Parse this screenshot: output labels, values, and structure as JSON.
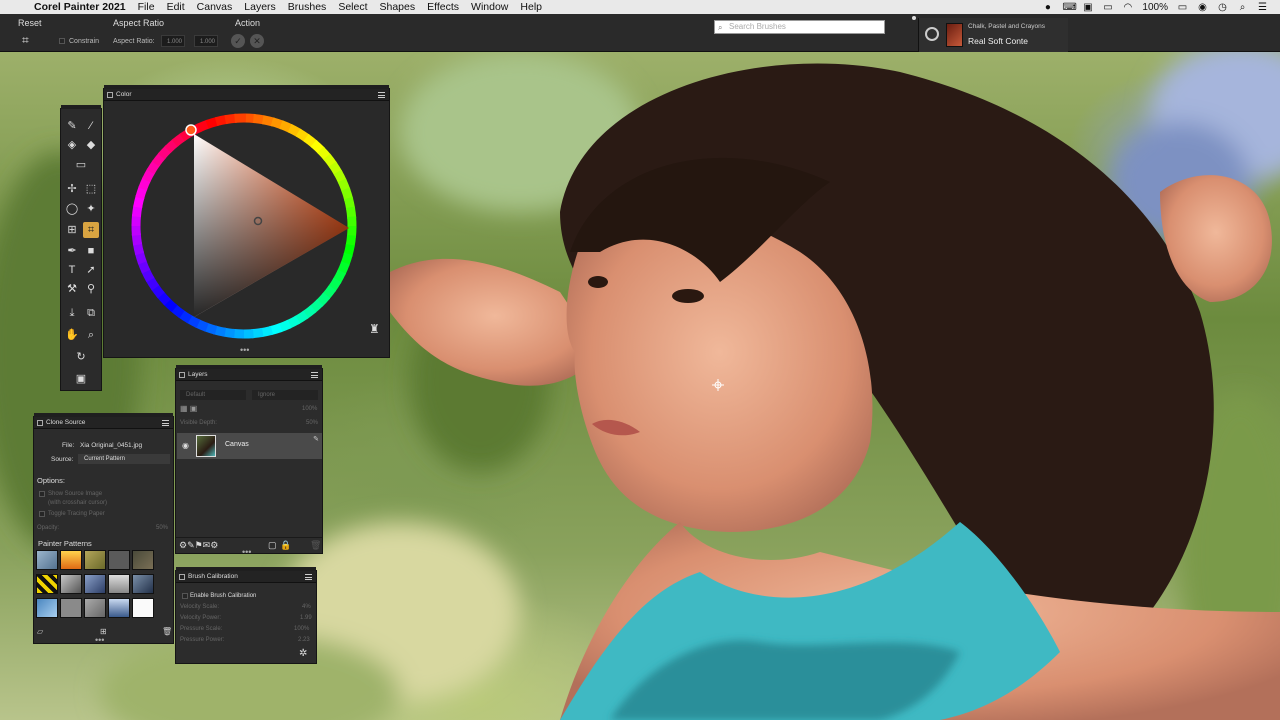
{
  "menubar": {
    "app": "Corel Painter 2021",
    "items": [
      "File",
      "Edit",
      "Canvas",
      "Layers",
      "Brushes",
      "Select",
      "Shapes",
      "Effects",
      "Window",
      "Help"
    ],
    "battery": "100%"
  },
  "propbar": {
    "reset": "Reset",
    "aspect_ratio": "Aspect Ratio",
    "action": "Action",
    "constrain": "Constrain",
    "aspect_ratio_field": "Aspect Ratio:",
    "width_value": "1.000",
    "height_value": "1.000",
    "search_placeholder": "Search Brushes",
    "brush_category": "Chalk, Pastel and Crayons",
    "brush_variant": "Real Soft Conte"
  },
  "color_panel": {
    "title": "Color",
    "main_color": "#c9704f",
    "hue_color": "#ff5a1a"
  },
  "layers_panel": {
    "title": "Layers",
    "composite_method": "Default",
    "composite_depth": "Ignore",
    "opacity": "100%",
    "visible_depth_label": "Visible Depth:",
    "visible_depth_value": "50%",
    "layer_name": "Canvas"
  },
  "clone_panel": {
    "title": "Clone Source",
    "file_label": "File:",
    "file_value": "Xia Original_0451.jpg",
    "source_label": "Source:",
    "source_value": "Current Pattern",
    "options_label": "Options:",
    "show_source": "Show Source Image",
    "show_source_sub": "(with crosshair cursor)",
    "toggle_tracing": "Toggle Tracing Paper",
    "opacity_label": "Opacity:",
    "opacity_value": "50%",
    "patterns_title": "Painter Patterns"
  },
  "calib_panel": {
    "title": "Brush Calibration",
    "enable": "Enable Brush Calibration",
    "rows": [
      {
        "label": "Velocity Scale:",
        "value": "4%"
      },
      {
        "label": "Velocity Power:",
        "value": "1.99"
      },
      {
        "label": "Pressure Scale:",
        "value": "100%"
      },
      {
        "label": "Pressure Power:",
        "value": "2.23"
      }
    ]
  }
}
